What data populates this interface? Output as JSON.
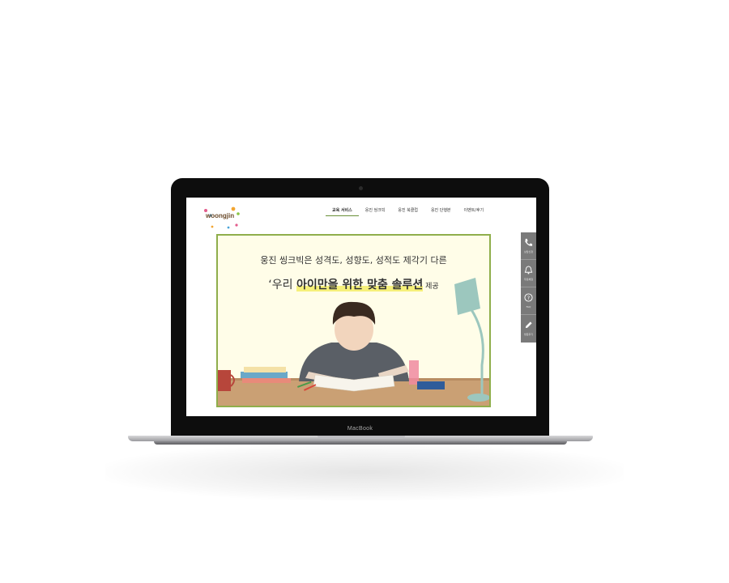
{
  "device": {
    "chin_label": "MacBook"
  },
  "site": {
    "logo_text": "woongjin",
    "nav": [
      {
        "label": "교육 서비스",
        "active": true
      },
      {
        "label": "웅진 씽크빅",
        "active": false
      },
      {
        "label": "웅진 북클럽",
        "active": false
      },
      {
        "label": "웅진 단행본",
        "active": false
      },
      {
        "label": "이벤트/후기",
        "active": false
      }
    ],
    "hero": {
      "line1": "웅진 씽크빅은 성격도, 성향도, 성적도 제각기 다른",
      "line2_prefix": "‘우리 ",
      "line2_highlight": "아이만을 위한 맞춤 솔루션",
      "line2_suffix": " 제공"
    },
    "quick_menu": [
      {
        "icon": "phone-icon",
        "label": "상담신청"
      },
      {
        "icon": "bell-icon",
        "label": "무료체험"
      },
      {
        "icon": "question-icon",
        "label": "FAQ"
      },
      {
        "icon": "pencil-icon",
        "label": "방문후기"
      }
    ]
  },
  "colors": {
    "hero_bg": "#fffde8",
    "hero_border": "#8fae4b",
    "highlight": "#f6f07a",
    "quick_menu_bg": "#7a7a7a"
  }
}
